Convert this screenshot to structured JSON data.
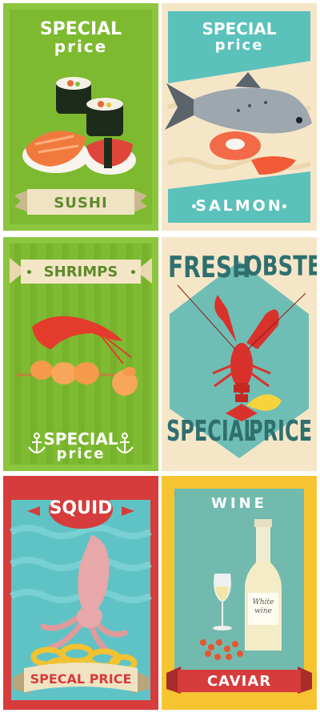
{
  "cards": {
    "sushi": {
      "line1": "SPECIAL",
      "line2": "price",
      "banner": "SUSHI"
    },
    "salmon": {
      "line1": "SPECIAL",
      "line2": "price",
      "banner": "SALMON"
    },
    "shrimps": {
      "banner": "SHRIMPS",
      "line1": "SPECIAL",
      "line2": "price"
    },
    "lobster": {
      "top_left": "FRESH",
      "top_right": "LOBSTER",
      "bottom_left": "SPECIAL",
      "bottom_right": "PRICE"
    },
    "squid": {
      "title": "SQUID",
      "banner": "SPECAL PRICE"
    },
    "wine": {
      "title": "WINE",
      "bottle_label_1": "White",
      "bottle_label_2": "wine",
      "banner": "CAVIAR"
    }
  },
  "colors": {
    "green": "#8cc63f",
    "cream": "#f5e6c8",
    "teal": "#5bc1bb",
    "red": "#d63c3c",
    "yellow": "#f6c431"
  }
}
